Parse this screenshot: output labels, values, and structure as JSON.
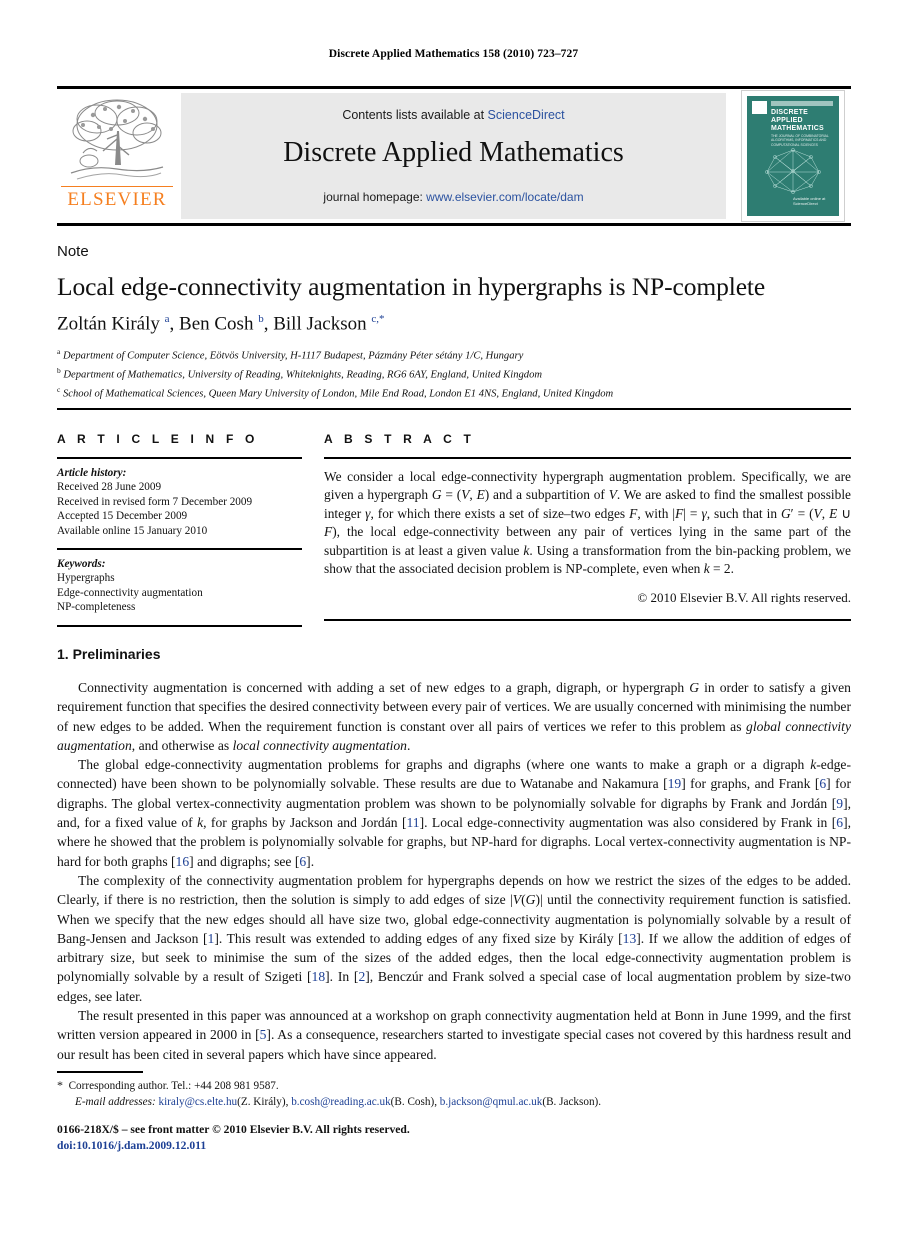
{
  "running_head": "Discrete Applied Mathematics 158 (2010) 723–727",
  "masthead": {
    "contents_prefix": "Contents lists available at ",
    "contents_link": "ScienceDirect",
    "journal_title": "Discrete Applied Mathematics",
    "homepage_prefix": "journal homepage: ",
    "homepage_link": "www.elsevier.com/locate/dam",
    "publisher_logo_text": "ELSEVIER",
    "accent_orange": "#F57F20",
    "link_blue": "#2b52a0",
    "band_bg": "#e9e9e9"
  },
  "cover": {
    "title_line1": "DISCRETE",
    "title_line2": "APPLIED",
    "title_line3": "MATHEMATICS",
    "subtitle": "THE JOURNAL OF COMBINATORIAL ALGORITHMS, INFORMATICS AND COMPUTATIONAL SCIENCES",
    "sciencedirect": "Available online at ScienceDirect",
    "bg_color": "#2e7d72"
  },
  "article": {
    "type_label": "Note",
    "title": "Local edge-connectivity augmentation in hypergraphs is NP-complete",
    "authors_html": "Zoltán Király <sup>a</sup>, Ben Cosh <sup>b</sup>, Bill Jackson <sup>c,</sup><sup>*</sup>",
    "affiliations": [
      {
        "marker": "a",
        "text": "Department of Computer Science, Eötvös University, H-1117 Budapest, Pázmány Péter sétány 1/C, Hungary"
      },
      {
        "marker": "b",
        "text": "Department of Mathematics, University of Reading, Whiteknights, Reading, RG6 6AY, England, United Kingdom"
      },
      {
        "marker": "c",
        "text": "School of Mathematical Sciences, Queen Mary University of London, Mile End Road, London E1 4NS, England, United Kingdom"
      }
    ]
  },
  "info": {
    "heading": "A R T I C L E   I N F O",
    "history_label": "Article history:",
    "history": [
      "Received 28 June 2009",
      "Received in revised form 7 December 2009",
      "Accepted 15 December 2009",
      "Available online 15 January 2010"
    ],
    "keywords_label": "Keywords:",
    "keywords": [
      "Hypergraphs",
      "Edge-connectivity augmentation",
      "NP-completeness"
    ]
  },
  "abstract": {
    "heading": "A B S T R A C T",
    "text_html": "We consider a local edge-connectivity hypergraph augmentation problem. Specifically, we are given a hypergraph <i>G</i> = (<i>V</i>, <i>E</i>) and a subpartition of <i>V</i>. We are asked to find the smallest possible integer <i>γ</i>, for which there exists a set of size–two edges <i>F</i>, with |<i>F</i>| = <i>γ</i>, such that in <i>G</i>′ = (<i>V</i>, <i>E</i> ∪ <i>F</i>), the local edge-connectivity between any pair of vertices lying in the same part of the subpartition is at least a given value <i>k</i>. Using a transformation from the bin-packing problem, we show that the associated decision problem is NP-complete, even when <i>k</i> = 2.",
    "copyright": "© 2010 Elsevier B.V. All rights reserved."
  },
  "section1": {
    "heading": "1. Preliminaries",
    "paragraphs_html": [
      "Connectivity augmentation is concerned with adding a set of new edges to a graph, digraph, or hypergraph <i>G</i> in order to satisfy a given requirement function that specifies the desired connectivity between every pair of vertices. We are usually concerned with minimising the number of new edges to be added. When the requirement function is constant over all pairs of vertices we refer to this problem as <i>global connectivity augmentation</i>, and otherwise as <i>local connectivity augmentation</i>.",
      "The global edge-connectivity augmentation problems for graphs and digraphs (where one wants to make a graph or a digraph <i>k</i>-edge-connected) have been shown to be polynomially solvable. These results are due to Watanabe and Nakamura [<span class=\"ref\">19</span>] for graphs, and Frank [<span class=\"ref\">6</span>] for digraphs. The global vertex-connectivity augmentation problem was shown to be polynomially solvable for digraphs by Frank and Jordán [<span class=\"ref\">9</span>], and, for a fixed value of <i>k</i>, for graphs by Jackson and Jordán [<span class=\"ref\">11</span>]. Local edge-connectivity augmentation was also considered by Frank in [<span class=\"ref\">6</span>], where he showed that the problem is polynomially solvable for graphs, but NP-hard for digraphs. Local vertex-connectivity augmentation is NP-hard for both graphs [<span class=\"ref\">16</span>] and digraphs; see [<span class=\"ref\">6</span>].",
      "The complexity of the connectivity augmentation problem for hypergraphs depends on how we restrict the sizes of the edges to be added. Clearly, if there is no restriction, then the solution is simply to add edges of size |<i>V</i>(<i>G</i>)| until the connectivity requirement function is satisfied. When we specify that the new edges should all have size two, global edge-connectivity augmentation is polynomially solvable by a result of Bang-Jensen and Jackson [<span class=\"ref\">1</span>]. This result was extended to adding edges of any fixed size by Király [<span class=\"ref\">13</span>]. If we allow the addition of edges of arbitrary size, but seek to minimise the sum of the sizes of the added edges, then the local edge-connectivity augmentation problem is polynomially solvable by a result of Szigeti [<span class=\"ref\">18</span>]. In [<span class=\"ref\">2</span>], Benczúr and Frank solved a special case of local augmentation problem by size-two edges, see later.",
      "The result presented in this paper was announced at a workshop on graph connectivity augmentation held at Bonn in June 1999, and the first written version appeared in 2000 in [<span class=\"ref\">5</span>]. As a consequence, researchers started to investigate special cases not covered by this hardness result and our result has been cited in several papers which have since appeared."
    ]
  },
  "footnotes": {
    "corresponding_html": "<span class=\"star\">*</span>&nbsp; Corresponding author. Tel.: +44 208 981 9587.",
    "emails_label": "E-mail addresses:",
    "emails": [
      {
        "address": "kiraly@cs.elte.hu",
        "name": "(Z. Király)"
      },
      {
        "address": "b.cosh@reading.ac.uk",
        "name": "(B. Cosh)"
      },
      {
        "address": "b.jackson@qmul.ac.uk",
        "name": "(B. Jackson)"
      }
    ]
  },
  "footer": {
    "issn_line": "0166-218X/$ – see front matter © 2010 Elsevier B.V. All rights reserved.",
    "doi": "doi:10.1016/j.dam.2009.12.011"
  }
}
